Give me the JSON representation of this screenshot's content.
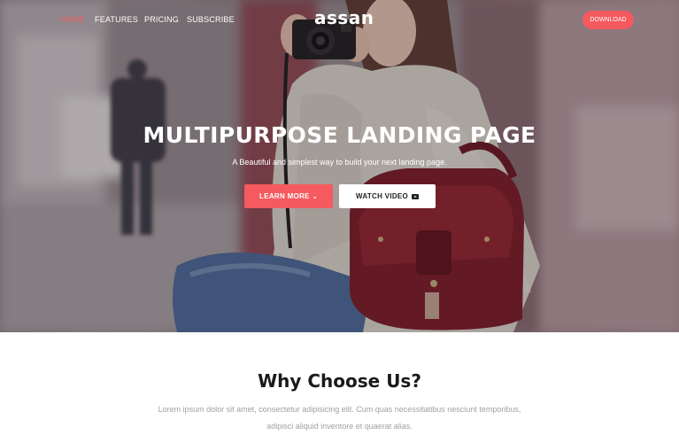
{
  "nav": {
    "links": [
      "HOME",
      "FEATURES",
      "PRICING",
      "SUBSCRIBE"
    ],
    "logo": "assan",
    "download": "DOWNLOAD"
  },
  "hero": {
    "title": "MULTIPURPOSE LANDING PAGE",
    "subtitle": "A Beautiful and simplest way to build your next landing page.",
    "learn_more": "LEARN MORE",
    "watch_video": "WATCH VIDEO"
  },
  "why": {
    "title": "Why Choose Us?",
    "text": "Lorem ipsum dolor sit amet, consectetur adipisicing elit. Cum quas necessitatibus nesciunt temporibus, adipisci aliquid inventore et quaerat alias."
  },
  "colors": {
    "accent": "#f45a5f"
  }
}
